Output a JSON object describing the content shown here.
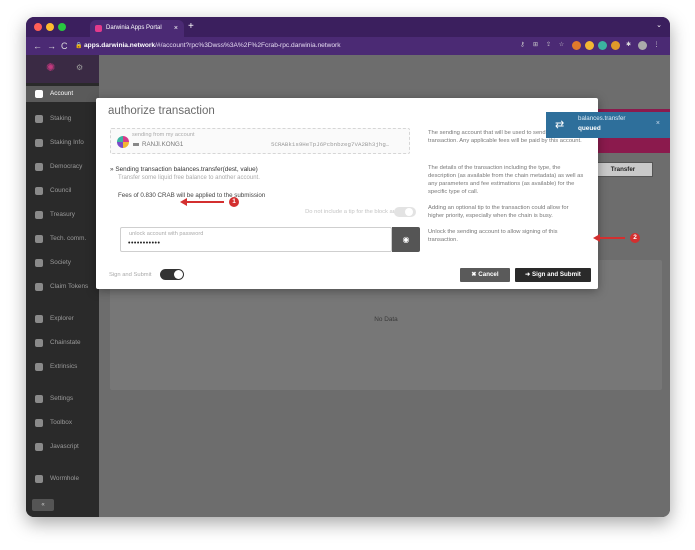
{
  "browser": {
    "tab_title": "Darwinia Apps Portal",
    "tab_close": "×",
    "new_tab": "+",
    "url_host": "apps.darwinia.network",
    "url_rest": "/#/account?rpc%3Dwss%3A%2F%2Fcrab-rpc.darwinia.network"
  },
  "sidebar": {
    "items": [
      {
        "label": "Account"
      },
      {
        "label": "Staking"
      },
      {
        "label": "Staking Info"
      },
      {
        "label": "Democracy"
      },
      {
        "label": "Council"
      },
      {
        "label": "Treasury"
      },
      {
        "label": "Tech. comm."
      },
      {
        "label": "Society"
      },
      {
        "label": "Claim Tokens"
      },
      {
        "label": "Explorer"
      },
      {
        "label": "Chainstate"
      },
      {
        "label": "Extrinsics"
      },
      {
        "label": "Settings"
      },
      {
        "label": "Toolbox"
      },
      {
        "label": "Javascript"
      },
      {
        "label": "Wormhole"
      }
    ],
    "collapse": "«"
  },
  "main": {
    "no_data": "No Data",
    "transfer_label": "Transfer"
  },
  "modal": {
    "title": "authorize transaction",
    "sending_label": "sending from my account",
    "account_name": "RANJI.KONG1",
    "account_address": "5CRABk1s9HeTpJ6Pcbnbzeg7VA2Bh3jhg…",
    "tx_title": "Sending transaction balances.transfer(dest, value)",
    "tx_subtitle": "Transfer some liquid free balance to another account.",
    "fees_text": "Fees of 0.830 CRAB will be applied to the submission",
    "tip_label": "Do not include a tip for the block author",
    "password_label": "unlock account with password",
    "password_value": "•••••••••••",
    "help_1": "The sending account that will be used to send this transaction. Any applicable fees will be paid by this account.",
    "help_2": "The details of the transaction including the type, the description (as available from the chain metadata) as well as any parameters and fee estimations (as available) for the specific type of call.",
    "help_3": "Adding an optional tip to the transaction could allow for higher priority, especially when the chain is busy.",
    "help_4": "Unlock the sending account to allow signing of this transaction.",
    "sign_label": "Sign and Submit",
    "cancel_label": "✖ Cancel",
    "submit_label": "➜ Sign and Submit"
  },
  "toast": {
    "title": "balances.transfer",
    "status": "queued"
  },
  "annotations": {
    "one": "1",
    "two": "2"
  },
  "colors": {
    "browser_chrome": "#4b2a74",
    "annotation": "#d32f2f",
    "toast": "#2e6f9b",
    "brand_pink": "#8b1a4d"
  }
}
